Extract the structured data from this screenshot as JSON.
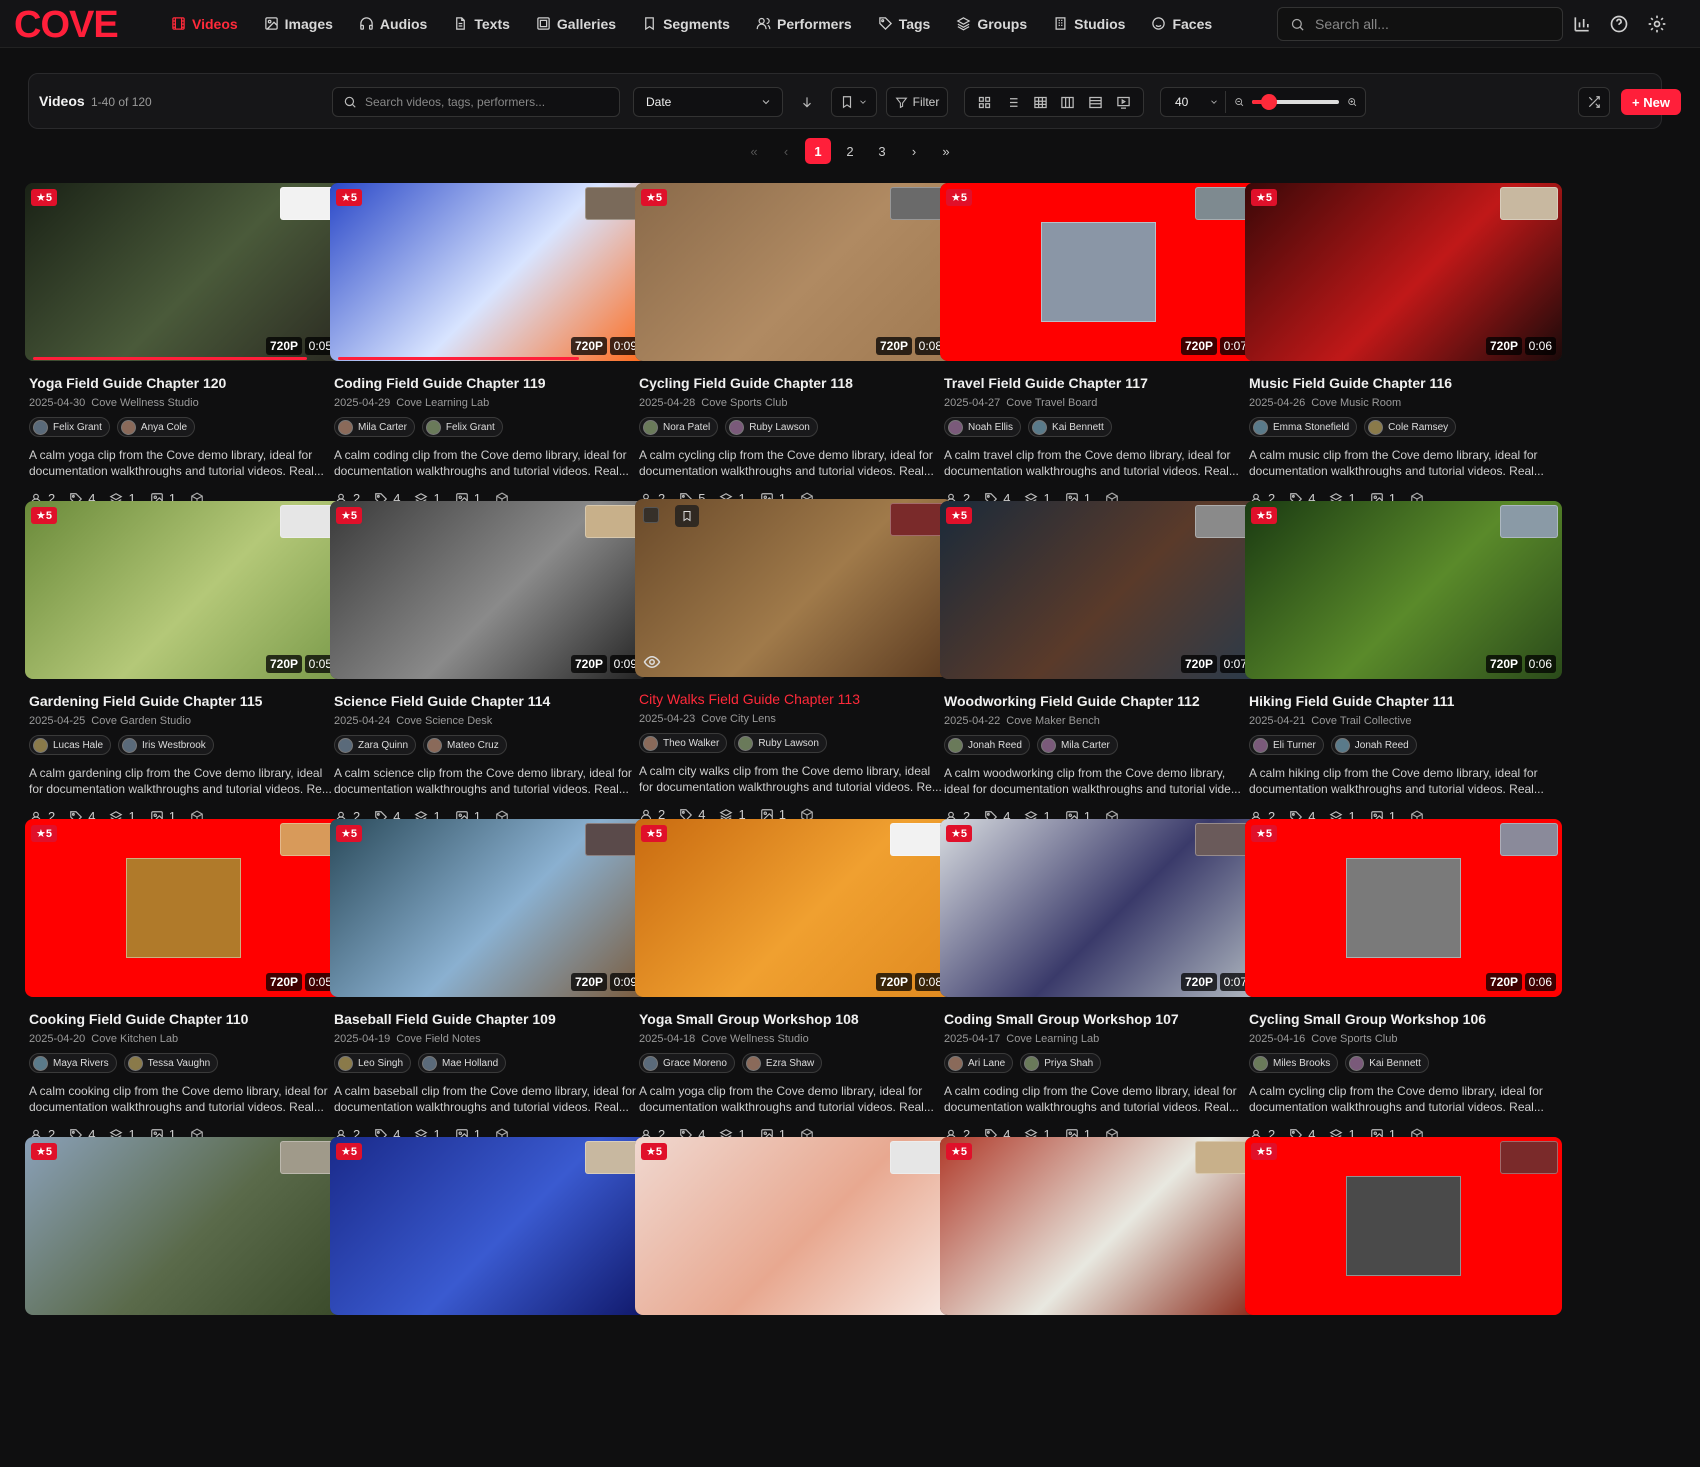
{
  "app": {
    "logo_text": "COVE",
    "brand_color": "#ff1f3a"
  },
  "nav": [
    {
      "label": "Videos",
      "icon": "film-icon",
      "active": true
    },
    {
      "label": "Images",
      "icon": "image-icon"
    },
    {
      "label": "Audios",
      "icon": "headphones-icon"
    },
    {
      "label": "Texts",
      "icon": "file-text-icon"
    },
    {
      "label": "Galleries",
      "icon": "gallery-icon"
    },
    {
      "label": "Segments",
      "icon": "bookmark-icon"
    },
    {
      "label": "Performers",
      "icon": "users-icon"
    },
    {
      "label": "Tags",
      "icon": "tag-icon"
    },
    {
      "label": "Groups",
      "icon": "layers-icon"
    },
    {
      "label": "Studios",
      "icon": "building-icon"
    },
    {
      "label": "Faces",
      "icon": "face-scan-icon"
    }
  ],
  "global_search": {
    "placeholder": "Search all..."
  },
  "toolbar": {
    "title": "Videos",
    "count": "1-40 of 120",
    "search_placeholder": "Search videos, tags, performers...",
    "sort_value": "Date",
    "filter_label": "Filter",
    "per_page": "40",
    "zoom_level": 0.2,
    "new_label": "+ New"
  },
  "pagination": {
    "pages": [
      "1",
      "2",
      "3"
    ],
    "current": "1"
  },
  "cards": [
    {
      "title": "Yoga Field Guide Chapter 120",
      "date": "2025-04-30",
      "studio": "Cove Wellness Studio",
      "performers": [
        "Felix Grant",
        "Anya Cole"
      ],
      "description": "A calm yoga clip from the Cove demo library, ideal for documentation walkthroughs and tutorial videos. Real...",
      "rating": "★5",
      "resolution": "720P",
      "duration": "0:05",
      "stats": {
        "performers": "2",
        "tags": "4",
        "groups": "1",
        "galleries": "1"
      },
      "scene_colors": [
        "#1a2216",
        "#4a5a3a",
        "#2b2b22"
      ],
      "mini_color": "#f2f2f2",
      "progress": 0.91
    },
    {
      "title": "Coding Field Guide Chapter 119",
      "date": "2025-04-29",
      "studio": "Cove Learning Lab",
      "performers": [
        "Mila Carter",
        "Felix Grant"
      ],
      "description": "A calm coding clip from the Cove demo library, ideal for documentation walkthroughs and tutorial videos. Real...",
      "rating": "★5",
      "resolution": "720P",
      "duration": "0:09",
      "stats": {
        "performers": "2",
        "tags": "4",
        "groups": "1",
        "galleries": "1"
      },
      "scene_colors": [
        "#2a48c8",
        "#d8e4ff",
        "#ff6a1a"
      ],
      "mini_color": "#7a6a5a",
      "progress": 0.8
    },
    {
      "title": "Cycling Field Guide Chapter 118",
      "date": "2025-04-28",
      "studio": "Cove Sports Club",
      "performers": [
        "Nora Patel",
        "Ruby Lawson"
      ],
      "description": "A calm cycling clip from the Cove demo library, ideal for documentation walkthroughs and tutorial videos. Real...",
      "rating": "★5",
      "resolution": "720P",
      "duration": "0:08",
      "stats": {
        "performers": "2",
        "tags": "5",
        "groups": "1",
        "galleries": "1"
      },
      "scene_colors": [
        "#8a6a4a",
        "#b08a62",
        "#a07a52"
      ],
      "mini_color": "#6a6a6a",
      "progress": 0
    },
    {
      "title": "Travel Field Guide Chapter 117",
      "date": "2025-04-27",
      "studio": "Cove Travel Board",
      "performers": [
        "Noah Ellis",
        "Kai Bennett"
      ],
      "description": "A calm travel clip from the Cove demo library, ideal for documentation walkthroughs and tutorial videos. Real...",
      "rating": "★5",
      "resolution": "720P",
      "duration": "0:07",
      "stats": {
        "performers": "2",
        "tags": "4",
        "groups": "1",
        "galleries": "1"
      },
      "scene_colors": [
        "#ff0000",
        "#ff0000",
        "#ff0000"
      ],
      "inner_color": "#8a96a6",
      "mini_color": "#7e8a90",
      "progress": 0
    },
    {
      "title": "Music Field Guide Chapter 116",
      "date": "2025-04-26",
      "studio": "Cove Music Room",
      "performers": [
        "Emma Stonefield",
        "Cole Ramsey"
      ],
      "description": "A calm music clip from the Cove demo library, ideal for documentation walkthroughs and tutorial videos. Real...",
      "rating": "★5",
      "resolution": "720P",
      "duration": "0:06",
      "stats": {
        "performers": "2",
        "tags": "4",
        "groups": "1",
        "galleries": "1"
      },
      "scene_colors": [
        "#3a0808",
        "#c01818",
        "#1a0a0a"
      ],
      "mini_color": "#c8b8a0",
      "progress": 0
    },
    {
      "title": "Gardening Field Guide Chapter 115",
      "date": "2025-04-25",
      "studio": "Cove Garden Studio",
      "performers": [
        "Lucas Hale",
        "Iris Westbrook"
      ],
      "description": "A calm gardening clip from the Cove demo library, ideal for documentation walkthroughs and tutorial videos. Re...",
      "rating": "★5",
      "resolution": "720P",
      "duration": "0:05",
      "stats": {
        "performers": "2",
        "tags": "4",
        "groups": "1",
        "galleries": "1"
      },
      "scene_colors": [
        "#6a8a3a",
        "#b4c878",
        "#7a9a4a"
      ],
      "mini_color": "#e6e6e6",
      "progress": 0
    },
    {
      "title": "Science Field Guide Chapter 114",
      "date": "2025-04-24",
      "studio": "Cove Science Desk",
      "performers": [
        "Zara Quinn",
        "Mateo Cruz"
      ],
      "description": "A calm science clip from the Cove demo library, ideal for documentation walkthroughs and tutorial videos. Real...",
      "rating": "★5",
      "resolution": "720P",
      "duration": "0:09",
      "stats": {
        "performers": "2",
        "tags": "4",
        "groups": "1",
        "galleries": "1"
      },
      "scene_colors": [
        "#3a3a3a",
        "#8a8a8a",
        "#222222"
      ],
      "mini_color": "#c8b08a",
      "progress": 0
    },
    {
      "title": "City Walks Field Guide Chapter 113",
      "date": "2025-04-23",
      "studio": "Cove City Lens",
      "performers": [
        "Theo Walker",
        "Ruby Lawson"
      ],
      "description": "A calm city walks clip from the Cove demo library, ideal for documentation walkthroughs and tutorial videos. Re...",
      "rating": "",
      "resolution": "",
      "duration": "",
      "stats": {
        "performers": "2",
        "tags": "4",
        "groups": "1",
        "galleries": "1"
      },
      "scene_colors": [
        "#6a4a2a",
        "#a07a4a",
        "#5a3a20"
      ],
      "mini_color": "#7a2a2a",
      "progress": 0,
      "hover": true
    },
    {
      "title": "Woodworking Field Guide Chapter 112",
      "date": "2025-04-22",
      "studio": "Cove Maker Bench",
      "performers": [
        "Jonah Reed",
        "Mila Carter"
      ],
      "description": "A calm woodworking clip from the Cove demo library, ideal for documentation walkthroughs and tutorial vide...",
      "rating": "★5",
      "resolution": "720P",
      "duration": "0:07",
      "stats": {
        "performers": "2",
        "tags": "4",
        "groups": "1",
        "galleries": "1"
      },
      "scene_colors": [
        "#1a2a3a",
        "#5a3a2a",
        "#2a3a4a"
      ],
      "mini_color": "#8a8a8a",
      "progress": 0
    },
    {
      "title": "Hiking Field Guide Chapter 111",
      "date": "2025-04-21",
      "studio": "Cove Trail Collective",
      "performers": [
        "Eli Turner",
        "Jonah Reed"
      ],
      "description": "A calm hiking clip from the Cove demo library, ideal for documentation walkthroughs and tutorial videos. Real...",
      "rating": "★5",
      "resolution": "720P",
      "duration": "0:06",
      "stats": {
        "performers": "2",
        "tags": "4",
        "groups": "1",
        "galleries": "1"
      },
      "scene_colors": [
        "#1a3a12",
        "#5a8a2a",
        "#2a4a1a"
      ],
      "mini_color": "#8a9aa6",
      "progress": 0
    },
    {
      "title": "Cooking Field Guide Chapter 110",
      "date": "2025-04-20",
      "studio": "Cove Kitchen Lab",
      "performers": [
        "Maya Rivers",
        "Tessa Vaughn"
      ],
      "description": "A calm cooking clip from the Cove demo library, ideal for documentation walkthroughs and tutorial videos. Real...",
      "rating": "★5",
      "resolution": "720P",
      "duration": "0:05",
      "stats": {
        "performers": "2",
        "tags": "4",
        "groups": "1",
        "galleries": "1"
      },
      "scene_colors": [
        "#ff0000",
        "#ff0000",
        "#ff0000"
      ],
      "inner_color": "#b07a2a",
      "mini_color": "#d89a5a",
      "progress": 0
    },
    {
      "title": "Baseball Field Guide Chapter 109",
      "date": "2025-04-19",
      "studio": "Cove Field Notes",
      "performers": [
        "Leo Singh",
        "Mae Holland"
      ],
      "description": "A calm baseball clip from the Cove demo library, ideal for documentation walkthroughs and tutorial videos. Real...",
      "rating": "★5",
      "resolution": "720P",
      "duration": "0:09",
      "stats": {
        "performers": "2",
        "tags": "4",
        "groups": "1",
        "galleries": "1"
      },
      "scene_colors": [
        "#2a4a5a",
        "#8ab0d0",
        "#7a5a3a"
      ],
      "mini_color": "#5a4a4a",
      "progress": 0
    },
    {
      "title": "Yoga Small Group Workshop 108",
      "date": "2025-04-18",
      "studio": "Cove Wellness Studio",
      "performers": [
        "Grace Moreno",
        "Ezra Shaw"
      ],
      "description": "A calm yoga clip from the Cove demo library, ideal for documentation walkthroughs and tutorial videos. Real...",
      "rating": "★5",
      "resolution": "720P",
      "duration": "0:08",
      "stats": {
        "performers": "2",
        "tags": "4",
        "groups": "1",
        "galleries": "1"
      },
      "scene_colors": [
        "#c86a10",
        "#f0a030",
        "#e08a20"
      ],
      "mini_color": "#f2f2f2",
      "progress": 0
    },
    {
      "title": "Coding Small Group Workshop 107",
      "date": "2025-04-17",
      "studio": "Cove Learning Lab",
      "performers": [
        "Ari Lane",
        "Priya Shah"
      ],
      "description": "A calm coding clip from the Cove demo library, ideal for documentation walkthroughs and tutorial videos. Real...",
      "rating": "★5",
      "resolution": "720P",
      "duration": "0:07",
      "stats": {
        "performers": "2",
        "tags": "4",
        "groups": "1",
        "galleries": "1"
      },
      "scene_colors": [
        "#d8dce0",
        "#3a3a6a",
        "#b0b8c0"
      ],
      "mini_color": "#6a5a5a",
      "progress": 0
    },
    {
      "title": "Cycling Small Group Workshop 106",
      "date": "2025-04-16",
      "studio": "Cove Sports Club",
      "performers": [
        "Miles Brooks",
        "Kai Bennett"
      ],
      "description": "A calm cycling clip from the Cove demo library, ideal for documentation walkthroughs and tutorial videos. Real...",
      "rating": "★5",
      "resolution": "720P",
      "duration": "0:06",
      "stats": {
        "performers": "2",
        "tags": "4",
        "groups": "1",
        "galleries": "1"
      },
      "scene_colors": [
        "#ff0000",
        "#ff0000",
        "#ff0000"
      ],
      "inner_color": "#7a7a7a",
      "mini_color": "#8a8a9a",
      "progress": 0
    },
    {
      "title": "",
      "date": "",
      "studio": "",
      "performers": [],
      "description": "",
      "rating": "★5",
      "resolution": "",
      "duration": "",
      "stats": null,
      "scene_colors": [
        "#8aa0b8",
        "#5a6a4a",
        "#3a4a2a"
      ],
      "mini_color": "#a09a8a",
      "progress": 0
    },
    {
      "title": "",
      "date": "",
      "studio": "",
      "performers": [],
      "description": "",
      "rating": "★5",
      "resolution": "",
      "duration": "",
      "stats": null,
      "scene_colors": [
        "#1a2a8a",
        "#3a5ad0",
        "#10186a"
      ],
      "mini_color": "#c8b8a0",
      "progress": 0
    },
    {
      "title": "",
      "date": "",
      "studio": "",
      "performers": [],
      "description": "",
      "rating": "★5",
      "resolution": "",
      "duration": "",
      "stats": null,
      "scene_colors": [
        "#f0d8d0",
        "#e8a890",
        "#f8eae4"
      ],
      "mini_color": "#e6e6e6",
      "progress": 0
    },
    {
      "title": "",
      "date": "",
      "studio": "",
      "performers": [],
      "description": "",
      "rating": "★5",
      "resolution": "",
      "duration": "",
      "stats": null,
      "scene_colors": [
        "#b03a2a",
        "#e8e8e0",
        "#8a2a1a"
      ],
      "mini_color": "#c8b08a",
      "progress": 0
    },
    {
      "title": "",
      "date": "",
      "studio": "",
      "performers": [],
      "description": "",
      "rating": "★5",
      "resolution": "",
      "duration": "",
      "stats": null,
      "scene_colors": [
        "#ff0000",
        "#ff0000",
        "#ff0000"
      ],
      "inner_color": "#4a4a4a",
      "mini_color": "#7a2a2a",
      "progress": 0
    }
  ],
  "avatar_colors": [
    "#5a6a7a",
    "#8a6a5a",
    "#6a7a5a",
    "#7a5a7a",
    "#5a7a8a",
    "#8a7a4a"
  ]
}
